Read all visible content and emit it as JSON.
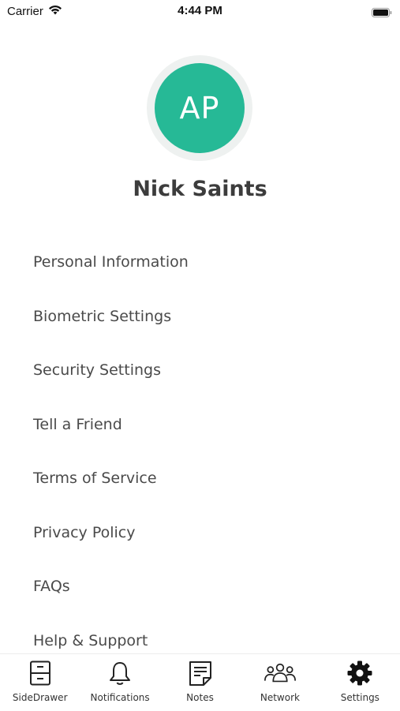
{
  "status_bar": {
    "carrier": "Carrier",
    "time": "4:44 PM"
  },
  "profile": {
    "initials": "AP",
    "name": "Nick Saints",
    "avatar_color": "#26b996"
  },
  "menu": {
    "items": [
      {
        "label": "Personal Information"
      },
      {
        "label": "Biometric Settings"
      },
      {
        "label": "Security Settings"
      },
      {
        "label": "Tell a Friend"
      },
      {
        "label": "Terms of Service"
      },
      {
        "label": "Privacy Policy"
      },
      {
        "label": "FAQs"
      },
      {
        "label": "Help & Support"
      }
    ]
  },
  "tab_bar": {
    "tabs": [
      {
        "label": "SideDrawer",
        "icon": "cabinet-icon"
      },
      {
        "label": "Notifications",
        "icon": "bell-icon"
      },
      {
        "label": "Notes",
        "icon": "note-icon"
      },
      {
        "label": "Network",
        "icon": "people-icon"
      },
      {
        "label": "Settings",
        "icon": "gear-icon",
        "active": true
      }
    ]
  }
}
